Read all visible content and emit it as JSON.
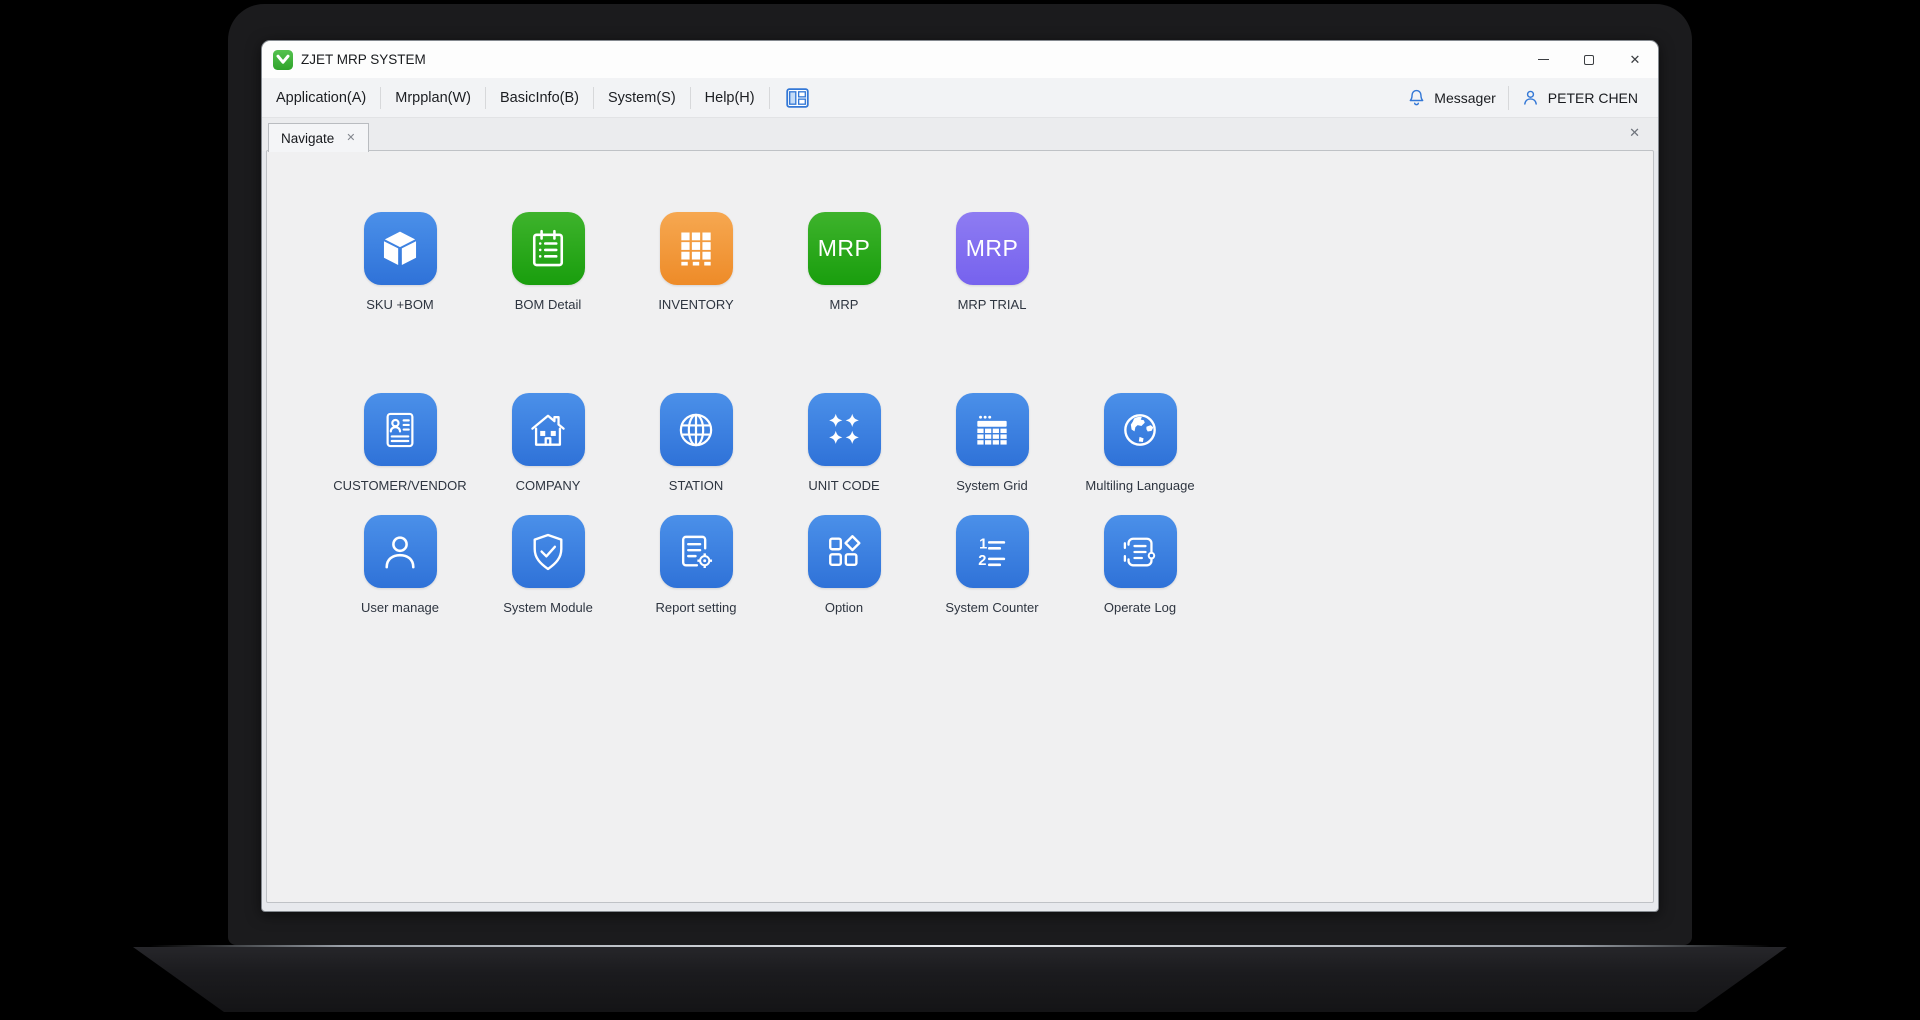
{
  "window": {
    "title": "ZJET MRP SYSTEM",
    "logo_icon": "zjet-logo-icon",
    "controls": {
      "minimize_icon": "minimize-icon",
      "maximize_icon": "maximize-icon",
      "close_icon": "close-icon"
    }
  },
  "menubar": {
    "items": [
      {
        "label": "Application(A)"
      },
      {
        "label": "Mrpplan(W)"
      },
      {
        "label": "BasicInfo(B)"
      },
      {
        "label": "System(S)"
      },
      {
        "label": "Help(H)"
      }
    ],
    "layout_icon": "layout-panes-icon",
    "right": {
      "bell_icon": "bell-icon",
      "messager_label": "Messager",
      "user_icon": "user-icon",
      "user_name": "PETER CHEN"
    }
  },
  "tabbar": {
    "tabs": [
      {
        "label": "Navigate",
        "active": true,
        "close_icon": "close-icon"
      }
    ],
    "right_close_icon": "close-icon"
  },
  "launcher": {
    "mrp_icon_text": "MRP",
    "rows": [
      {
        "items": [
          {
            "label": "SKU +BOM",
            "icon": "cube-icon",
            "color": "blue"
          },
          {
            "label": "BOM Detail",
            "icon": "clipboard-list-icon",
            "color": "green"
          },
          {
            "label": "INVENTORY",
            "icon": "pallet-boxes-icon",
            "color": "orange"
          },
          {
            "label": "MRP",
            "icon": "mrp-text-icon",
            "color": "green"
          },
          {
            "label": "MRP TRIAL",
            "icon": "mrp-text-icon",
            "color": "purple"
          }
        ]
      },
      {
        "items": [
          {
            "label": "CUSTOMER/VENDOR",
            "icon": "id-card-icon",
            "color": "blue"
          },
          {
            "label": "COMPANY",
            "icon": "house-icon",
            "color": "blue"
          },
          {
            "label": "STATION",
            "icon": "globe-grid-icon",
            "color": "blue"
          },
          {
            "label": "UNIT CODE",
            "icon": "sparkles-icon",
            "color": "blue"
          },
          {
            "label": "System Grid",
            "icon": "table-icon",
            "color": "blue"
          },
          {
            "label": "Multiling Language",
            "icon": "earth-icon",
            "color": "blue"
          }
        ]
      },
      {
        "items": [
          {
            "label": "User manage",
            "icon": "person-icon",
            "color": "blue"
          },
          {
            "label": "System Module",
            "icon": "shield-check-icon",
            "color": "blue"
          },
          {
            "label": "Report setting",
            "icon": "report-gear-icon",
            "color": "blue"
          },
          {
            "label": "Option",
            "icon": "shapes-icon",
            "color": "blue"
          },
          {
            "label": "System Counter",
            "icon": "numbered-list-icon",
            "color": "blue"
          },
          {
            "label": "Operate Log",
            "icon": "operate-log-icon",
            "color": "blue"
          }
        ]
      }
    ]
  },
  "colors": {
    "tile_blue_top": "#4b90e9",
    "tile_blue_bottom": "#2f72d8",
    "tile_green_top": "#3eb32c",
    "tile_green_bottom": "#199e0d",
    "tile_orange_top": "#f6a851",
    "tile_orange_bottom": "#ee8b28",
    "tile_purple_top": "#8e7cf2",
    "tile_purple_bottom": "#7662ee",
    "accent_blue": "#3478d6",
    "logo_green": "#3fae3b",
    "content_bg": "#f0f0f1"
  }
}
